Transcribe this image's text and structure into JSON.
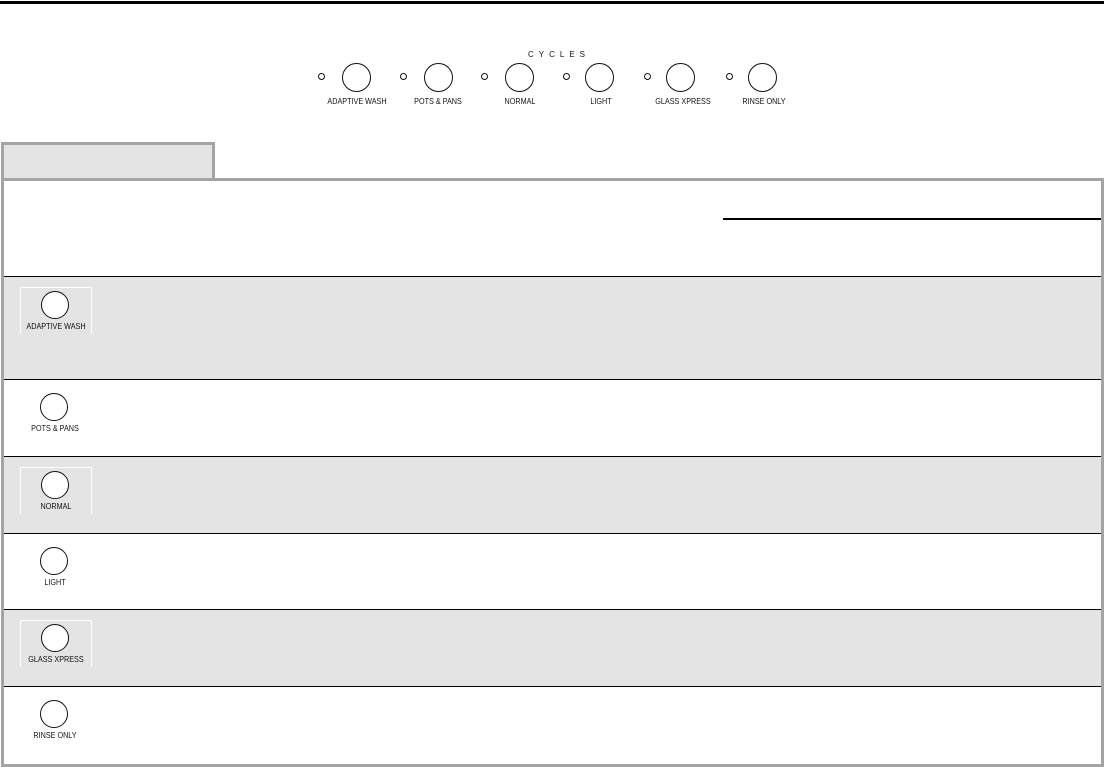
{
  "panel": {
    "title": "CYCLES",
    "buttons": [
      {
        "label": "ADAPTIVE WASH"
      },
      {
        "label": "POTS & PANS"
      },
      {
        "label": "NORMAL"
      },
      {
        "label": "LIGHT"
      },
      {
        "label": "GLASS XPRESS"
      },
      {
        "label": "RINSE ONLY"
      }
    ]
  },
  "table": {
    "tab_label": "",
    "rows": [
      {
        "cycle": "ADAPTIVE WASH",
        "shaded": true
      },
      {
        "cycle": "POTS & PANS",
        "shaded": false
      },
      {
        "cycle": "NORMAL",
        "shaded": true
      },
      {
        "cycle": "LIGHT",
        "shaded": false
      },
      {
        "cycle": "GLASS XPRESS",
        "shaded": true
      },
      {
        "cycle": "RINSE ONLY",
        "shaded": false
      }
    ]
  },
  "colors": {
    "frame_gray": "#a4a4a4",
    "shade_gray": "#e4e4e4",
    "ink": "#111111"
  }
}
